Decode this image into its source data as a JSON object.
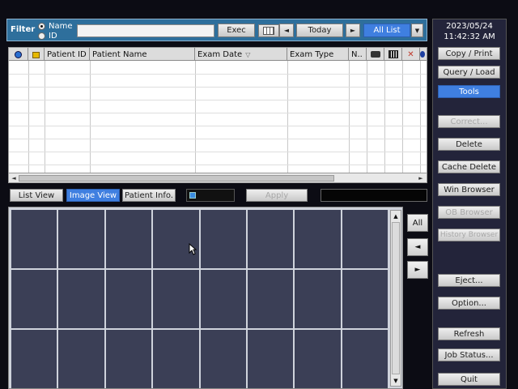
{
  "filter": {
    "label": "Filter",
    "radio_name": "Name",
    "radio_id": "ID",
    "search_value": "",
    "exec": "Exec",
    "today": "Today",
    "prev": "◄",
    "next": "►",
    "all_list": "All List",
    "dropdown": "▼"
  },
  "table": {
    "headers": [
      "Patient ID",
      "Patient Name",
      "Exam Date",
      "Exam Type",
      "N.."
    ],
    "sort_indicator": "▽",
    "scroll_left": "◄",
    "scroll_right": "►"
  },
  "views": {
    "list_view": "List View",
    "image_view": "Image View",
    "patient_info": "Patient Info.",
    "apply": "Apply"
  },
  "nav": {
    "all": "All",
    "left": "◄",
    "right": "►",
    "up": "▲",
    "down": "▼"
  },
  "sidebar": {
    "date": "2023/05/24",
    "time": "11:42:32 AM",
    "buttons": {
      "copy_print": "Copy / Print",
      "query_load": "Query / Load",
      "tools": "Tools",
      "correct": "Correct...",
      "delete": "Delete",
      "cache_delete": "Cache Delete",
      "win_browser": "Win Browser",
      "ob_browser": "OB Browser",
      "history_browser": "History Browser",
      "eject": "Eject...",
      "option": "Option...",
      "refresh": "Refresh",
      "job_status": "Job Status...",
      "quit": "Quit"
    }
  },
  "colors": {
    "filter_bar": "#2e6f9c",
    "selected_button": "#3f7fe0",
    "grid_cell": "#3b3f56",
    "panel": "#23243a"
  }
}
